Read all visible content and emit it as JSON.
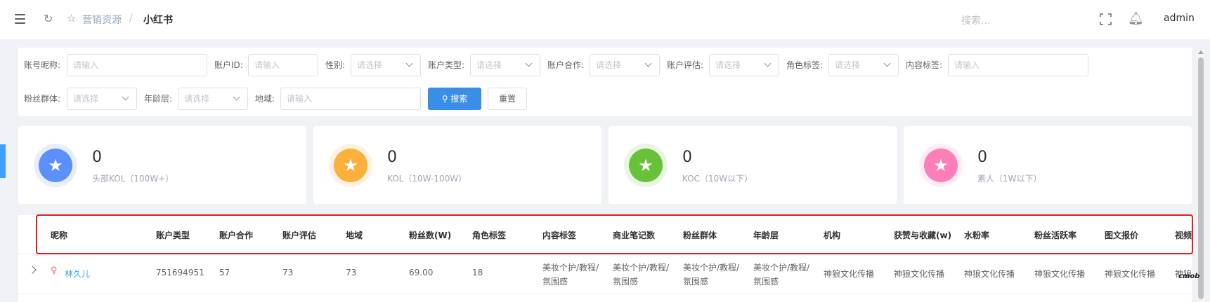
{
  "breadcrumb": {
    "parent": "营销资源",
    "separator": "/",
    "current": "小红书"
  },
  "topbar": {
    "search_placeholder": "搜索...",
    "user": "admin"
  },
  "filters": {
    "nickname_label": "账号昵称:",
    "nickname_placeholder": "请输入",
    "account_id_label": "账户ID:",
    "account_id_placeholder": "请输入",
    "gender_label": "性别:",
    "gender_placeholder": "请选择",
    "account_type_label": "账户类型:",
    "account_type_placeholder": "请选择",
    "cooperation_label": "账户合作:",
    "cooperation_placeholder": "请选择",
    "evaluation_label": "账户评估:",
    "evaluation_placeholder": "请选择",
    "role_tag_label": "角色标签:",
    "role_tag_placeholder": "请选择",
    "content_tag_label": "内容标签:",
    "content_tag_placeholder": "请输入",
    "fan_group_label": "粉丝群体:",
    "fan_group_placeholder": "请选择",
    "age_label": "年龄层:",
    "age_placeholder": "请选择",
    "region_label": "地域:",
    "region_placeholder": "请输入",
    "search_button": "搜索",
    "reset_button": "重置"
  },
  "stats": [
    {
      "value": "0",
      "label": "头部KOL（100W+）",
      "color": "#5b8ff9"
    },
    {
      "value": "0",
      "label": "KOL（10W-100W）",
      "color": "#fbb03b"
    },
    {
      "value": "0",
      "label": "KOC（10W以下）",
      "color": "#67c23a"
    },
    {
      "value": "0",
      "label": "素人（1W以下）",
      "color": "#ff7eb8"
    }
  ],
  "table": {
    "headers": [
      "昵称",
      "账户类型",
      "账户合作",
      "账户评估",
      "地域",
      "粉丝数(W)",
      "角色标签",
      "内容标签",
      "商业笔记数",
      "粉丝群体",
      "年龄层",
      "机构",
      "获赞与收藏(w)",
      "水粉率",
      "粉丝活跃率",
      "图文报价",
      "视频"
    ],
    "row": {
      "nickname": "林久儿",
      "account_type": "751694951",
      "cooperation": "57",
      "evaluation": "73",
      "region": "73",
      "fans": "69.00",
      "role_tag": "18",
      "content_tag": "美妆个护/教程/氛围感",
      "commercial_notes": "美妆个护/教程/氛围感",
      "fan_group": "美妆个护/教程/氛围感",
      "age": "美妆个护/教程/氛围感",
      "org": "神狼文化传播",
      "likes": "神狼文化传播",
      "water_rate": "神狼文化传播",
      "active_rate": "神狼文化传播",
      "image_price": "神狼文化传播",
      "video": "神狼"
    }
  },
  "watermark": "cmob"
}
